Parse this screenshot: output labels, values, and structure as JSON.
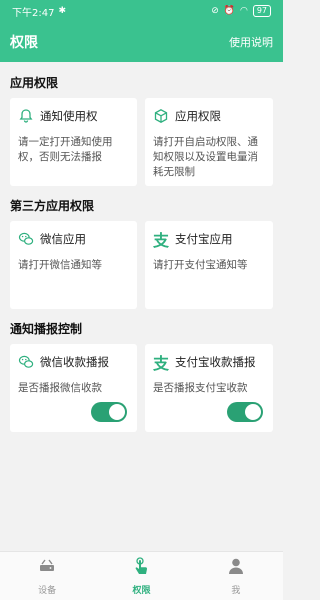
{
  "status_bar": {
    "time": "下午2:47",
    "battery": "97"
  },
  "app_bar": {
    "title": "权限",
    "help_label": "使用说明"
  },
  "sections": {
    "app_permissions": {
      "title": "应用权限",
      "cards": [
        {
          "icon": "bell-icon",
          "label": "通知使用权",
          "desc": "请一定打开通知使用权，否则无法播报"
        },
        {
          "icon": "cube-icon",
          "label": "应用权限",
          "desc": "请打开自启动权限、通知权限以及设置电量消耗无限制"
        }
      ]
    },
    "third_party": {
      "title": "第三方应用权限",
      "cards": [
        {
          "icon": "wechat-icon",
          "label": "微信应用",
          "desc": "请打开微信通知等"
        },
        {
          "icon": "alipay-icon",
          "label": "支付宝应用",
          "desc": "请打开支付宝通知等"
        }
      ]
    },
    "broadcast": {
      "title": "通知播报控制",
      "cards": [
        {
          "icon": "wechat-icon",
          "label": "微信收款播报",
          "desc": "是否播报微信收款",
          "enabled": true
        },
        {
          "icon": "alipay-icon",
          "label": "支付宝收款播报",
          "desc": "是否播报支付宝收款",
          "enabled": true
        }
      ]
    }
  },
  "tabs": [
    {
      "label": "设备",
      "icon": "router-icon",
      "active": false
    },
    {
      "label": "权限",
      "icon": "hand-tap-icon",
      "active": true
    },
    {
      "label": "我",
      "icon": "person-icon",
      "active": false
    }
  ],
  "colors": {
    "primary": "#3ac28f",
    "toggle_on": "#2aa174",
    "icon": "#2fb07f"
  }
}
